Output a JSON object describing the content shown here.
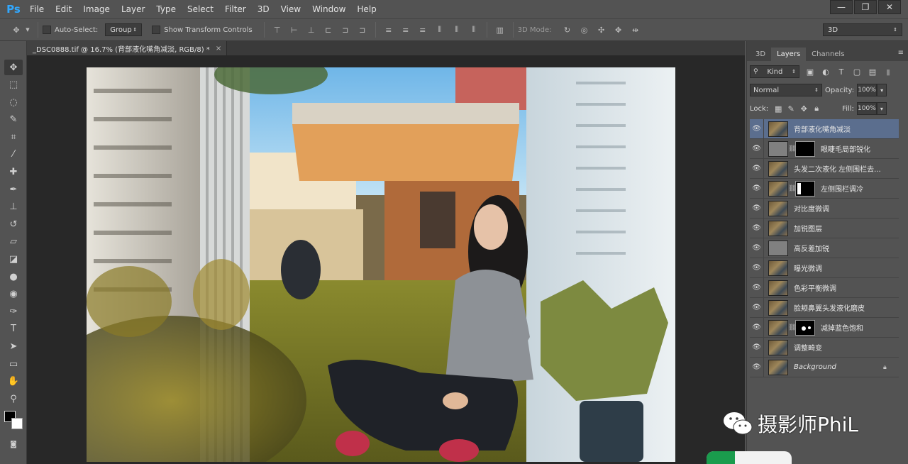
{
  "app": {
    "logo": "Ps",
    "menu": [
      "File",
      "Edit",
      "Image",
      "Layer",
      "Type",
      "Select",
      "Filter",
      "3D",
      "View",
      "Window",
      "Help"
    ],
    "window_controls": [
      "—",
      "❐",
      "✕"
    ]
  },
  "options_bar": {
    "auto_select_label": "Auto-Select:",
    "auto_select_value": "Group",
    "show_transform_label": "Show Transform Controls",
    "mode_label": "3D Mode:",
    "workspace_value": "3D"
  },
  "document": {
    "tab_title": "_DSC0888.tif @ 16.7% (背部液化嘴角减淡, RGB/8) *",
    "tab_close": "×"
  },
  "panels": {
    "tabs": [
      "3D",
      "Layers",
      "Channels"
    ],
    "active_tab": "Layers",
    "kind_label": "Kind",
    "blend_mode": "Normal",
    "opacity_label": "Opacity:",
    "opacity_value": "100%",
    "lock_label": "Lock:",
    "fill_label": "Fill:",
    "fill_value": "100%"
  },
  "layers": [
    {
      "name": "背部液化嘴角减淡",
      "selected": true,
      "thumb": "photo",
      "mask": "none"
    },
    {
      "name": "眼睫毛局部锐化",
      "selected": false,
      "thumb": "gray",
      "mask": "black"
    },
    {
      "name": "头发二次液化 左侧围栏去...",
      "selected": false,
      "thumb": "photo",
      "mask": "none"
    },
    {
      "name": "左侧围栏调冷",
      "selected": false,
      "thumb": "photo",
      "mask": "white-bar"
    },
    {
      "name": "对比度微调",
      "selected": false,
      "thumb": "photo",
      "mask": "none"
    },
    {
      "name": "加锐图层",
      "selected": false,
      "thumb": "photo",
      "mask": "none"
    },
    {
      "name": "高反差加锐",
      "selected": false,
      "thumb": "gray",
      "mask": "none"
    },
    {
      "name": "曝光微调",
      "selected": false,
      "thumb": "photo",
      "mask": "none"
    },
    {
      "name": "色彩平衡微调",
      "selected": false,
      "thumb": "photo",
      "mask": "none"
    },
    {
      "name": "脸颊鼻翼头发液化磨皮",
      "selected": false,
      "thumb": "photo",
      "mask": "none"
    },
    {
      "name": "减掉蓝色饱和",
      "selected": false,
      "thumb": "photo",
      "mask": "white-dots"
    },
    {
      "name": "调整畸变",
      "selected": false,
      "thumb": "photo",
      "mask": "none"
    },
    {
      "name": "Background",
      "selected": false,
      "thumb": "photo",
      "mask": "none",
      "italic": true,
      "locked": true
    }
  ],
  "watermark": {
    "text": "摄影师PhiL"
  },
  "colors": {
    "ui_bg": "#535353",
    "canvas_bg": "#282828",
    "selected_layer": "#5b6e8e",
    "ps_blue": "#31a8ff"
  }
}
